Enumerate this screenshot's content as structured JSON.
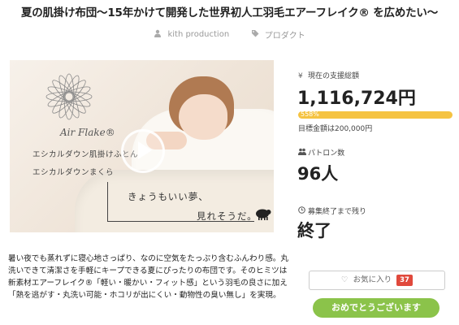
{
  "title": "夏の肌掛け布団〜15年かけて開発した世界初人工羽毛エアーフレイク® を広めたい〜",
  "meta": {
    "owner": "kith production",
    "category": "プロダクト",
    "owner_icon": "user-icon",
    "category_icon": "tag-icon"
  },
  "hero": {
    "brand": "Air Flake®",
    "line1": "エシカルダウン肌掛けふとん",
    "line2": "エシカルダウンまくら",
    "caption1": "きょうもいい夢、",
    "caption2": "見れそうだ。"
  },
  "stats": {
    "funding_label": "現在の支援総額",
    "funding_icon": "yen-icon",
    "funding_value": "1,116,724円",
    "progress_percent": 558,
    "progress_label": "558%",
    "goal_text": "目標金額は200,000円",
    "patron_label": "パトロン数",
    "patron_icon": "users-icon",
    "patron_value": "96人",
    "remaining_label": "募集終了まで残り",
    "remaining_icon": "clock-icon",
    "remaining_value": "終了"
  },
  "description": "暑い夜でも蒸れずに寝心地さっぱり、なのに空気をたっぷり含むふんわり感。丸洗いできて清潔さを手軽にキープできる夏にぴったりの布団です。そのヒミツは新素材エアーフレイク®「軽い・暖かい・フィット感」という羽毛の良さに加え「熱を逃がす・丸洗い可能・ホコリが出にくい・動物性の臭い無し」を実現。",
  "actions": {
    "favorite_label": "お気に入り",
    "favorite_count": "37",
    "thanks_label": "おめでとうございます"
  },
  "colors": {
    "progress": "#f5c342",
    "thanks_button": "#8bc34a",
    "badge": "#e0493c"
  }
}
